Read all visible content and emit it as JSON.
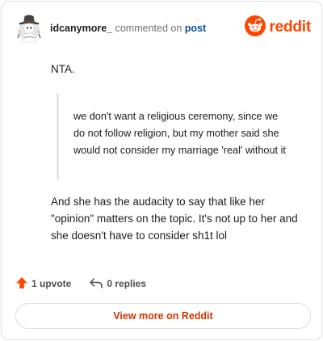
{
  "header": {
    "username": "idcanymore_",
    "action_text": "commented on",
    "post_link": "post",
    "brand_name": "reddit",
    "brand_color": "#ff4500",
    "avatar_icon": "cowboy-avatar-icon",
    "brand_icon": "reddit-logo-icon"
  },
  "comment": {
    "opening": "NTA.",
    "quote": "we don't want a religious ceremony, since we do not follow religion, but my mother said she would not consider my marriage 'real' without it",
    "reply": "And she has the audacity to say that like her \"opinion\" matters on the topic. It's not up to her and she doesn't have to consider sh1t lol"
  },
  "footer": {
    "upvote_label": "1 upvote",
    "replies_label": "0 replies",
    "upvote_icon": "upvote-arrow-icon",
    "reply_icon": "reply-arrow-icon",
    "upvote_color": "#ff4500"
  },
  "cta": {
    "view_more_label": "View more on Reddit",
    "color": "#cc3700"
  }
}
